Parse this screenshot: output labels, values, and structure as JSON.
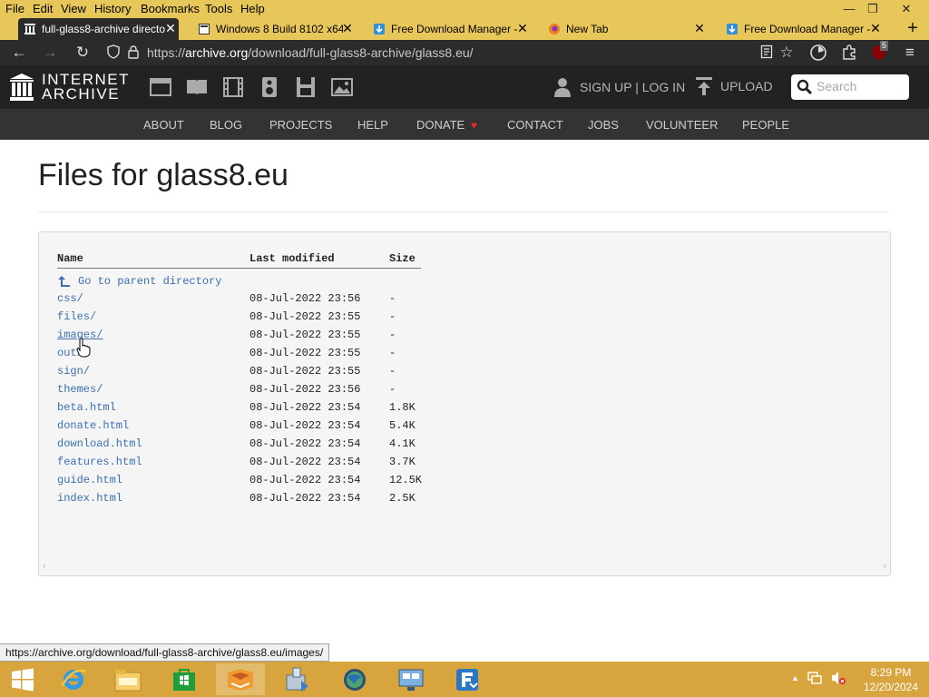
{
  "menubar": {
    "items": [
      "File",
      "Edit",
      "View",
      "History",
      "Bookmarks",
      "Tools",
      "Help"
    ],
    "min_label": "—",
    "restore_label": "❐",
    "close_label": "✕"
  },
  "tabs": [
    {
      "title": "full-glass8-archive directo",
      "icon": "archive-icon",
      "active": true
    },
    {
      "title": "Windows 8 Build 8102 x64",
      "icon": "page-icon",
      "active": false
    },
    {
      "title": "Free Download Manager -",
      "icon": "fdm-icon",
      "active": false
    },
    {
      "title": "New Tab",
      "icon": "firefox-icon",
      "active": false
    },
    {
      "title": "Free Download Manager -",
      "icon": "fdm-icon",
      "active": false
    }
  ],
  "tab_close_label": "✕",
  "new_tab_label": "+",
  "address_bar": {
    "prefix": "https://",
    "host": "archive.org",
    "path": "/download/full-glass8-archive/glass8.eu/"
  },
  "toolbar_badge": "5",
  "ia_header": {
    "logo_line1": "INTERNET",
    "logo_line2": "ARCHIVE",
    "signup_label": "SIGN UP | LOG IN",
    "upload_label": "UPLOAD",
    "search_placeholder": "Search"
  },
  "ia_nav": [
    "ABOUT",
    "BLOG",
    "PROJECTS",
    "HELP",
    "DONATE",
    "CONTACT",
    "JOBS",
    "VOLUNTEER",
    "PEOPLE"
  ],
  "page_title": "Files for glass8.eu",
  "listing": {
    "headers": {
      "name": "Name",
      "modified": "Last modified",
      "size": "Size"
    },
    "parent_link": "Go to parent directory",
    "rows": [
      {
        "name": "css/",
        "modified": "08-Jul-2022 23:56",
        "size": "-"
      },
      {
        "name": "files/",
        "modified": "08-Jul-2022 23:55",
        "size": "-"
      },
      {
        "name": "images/",
        "modified": "08-Jul-2022 23:55",
        "size": "-"
      },
      {
        "name": "out/",
        "modified": "08-Jul-2022 23:55",
        "size": "-"
      },
      {
        "name": "sign/",
        "modified": "08-Jul-2022 23:55",
        "size": "-"
      },
      {
        "name": "themes/",
        "modified": "08-Jul-2022 23:56",
        "size": "-"
      },
      {
        "name": "beta.html",
        "modified": "08-Jul-2022 23:54",
        "size": "1.8K"
      },
      {
        "name": "donate.html",
        "modified": "08-Jul-2022 23:54",
        "size": "5.4K"
      },
      {
        "name": "download.html",
        "modified": "08-Jul-2022 23:54",
        "size": "4.1K"
      },
      {
        "name": "features.html",
        "modified": "08-Jul-2022 23:54",
        "size": "3.7K"
      },
      {
        "name": "guide.html",
        "modified": "08-Jul-2022 23:54",
        "size": "12.5K"
      },
      {
        "name": "index.html",
        "modified": "08-Jul-2022 23:54",
        "size": "2.5K"
      }
    ]
  },
  "status_url": "https://archive.org/download/full-glass8-archive/glass8.eu/images/",
  "clock": {
    "time": "8:29 PM",
    "date": "12/20/2024"
  },
  "colors": {
    "link": "#3a6fb0",
    "ia_header_bg": "#222222",
    "ia_nav_bg": "#333333",
    "taskbar": "#d8a43d",
    "firefox_frame": "#e8c75a",
    "donate_heart": "#e32b2b"
  }
}
